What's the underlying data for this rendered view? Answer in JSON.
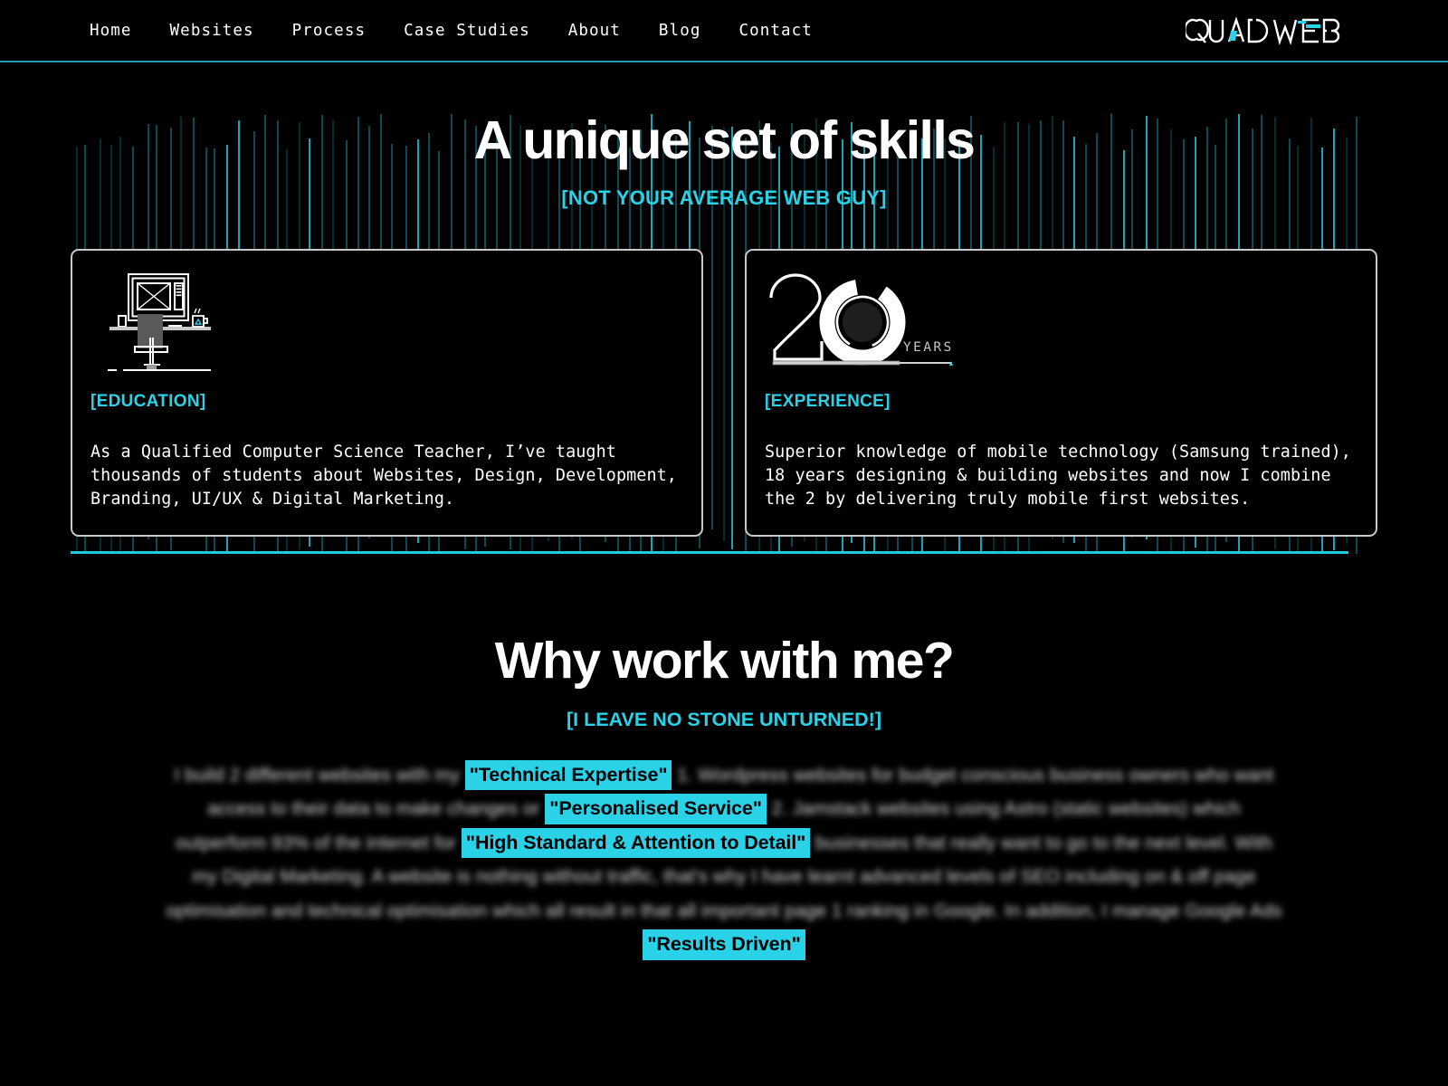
{
  "brand": {
    "logo_text": "QUAD WEB",
    "accent_color": "#2ad2e8"
  },
  "nav": {
    "items": [
      {
        "label": "Home"
      },
      {
        "label": "Websites"
      },
      {
        "label": "Process"
      },
      {
        "label": "Case Studies"
      },
      {
        "label": "About"
      },
      {
        "label": "Blog"
      },
      {
        "label": "Contact"
      }
    ]
  },
  "skills": {
    "heading": "A unique set of skills",
    "subheading": "[NOT YOUR AVERAGE WEB GUY]",
    "cards": [
      {
        "icon": "desk-workspace-icon",
        "label": "[EDUCATION]",
        "body": "As a Qualified Computer Science Teacher, I’ve taught thousands of students about Websites, Design, Development, Branding, UI/UX & Digital Marketing."
      },
      {
        "icon": "twenty-years-icon",
        "icon_number": "20",
        "icon_unit": "YEARS",
        "label": "[EXPERIENCE]",
        "body": "Superior knowledge of mobile technology (Samsung trained), 18 years designing & building websites and now I combine the 2 by delivering truly mobile first websites."
      }
    ]
  },
  "why": {
    "heading": "Why work with me?",
    "subheading": "[I LEAVE NO STONE UNTURNED!]",
    "paragraph": {
      "seg1": "I build 2 different websites with my ",
      "hl1": "\"Technical Expertise\"",
      "seg2": " 1. Wordpress websites for budget conscious business owners who want access to their data to make changes or ",
      "hl2": "\"Personalised Service\"",
      "seg3": " 2. Jamstack websites using Astro (static websites) which outperform 93% of the internet for ",
      "hl3": "\"High Standard & Attention to Detail\"",
      "seg4": " businesses that really want to go to the next level. With my Digital Marketing. A website is nothing without traffic, that's why I have learnt advanced levels of SEO including on & off page optimisation and technical optimisation which all result in that all important page 1 ranking in Google. In addition, I manage Google Ads ",
      "hl4": "\"Results Driven\""
    }
  }
}
